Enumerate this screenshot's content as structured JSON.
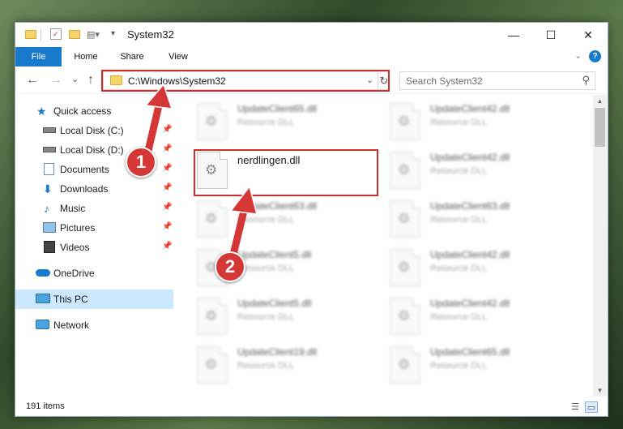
{
  "window": {
    "title": "System32",
    "controls": {
      "minimize": "—",
      "maximize": "☐",
      "close": "✕"
    }
  },
  "ribbon": {
    "tabs": [
      {
        "label": "File"
      },
      {
        "label": "Home"
      },
      {
        "label": "Share"
      },
      {
        "label": "View"
      }
    ],
    "help_label": "?"
  },
  "navigation": {
    "back": "←",
    "forward": "→",
    "recent": "⌄",
    "up": "↑",
    "address": "C:\\Windows\\System32",
    "refresh": "↻",
    "search_placeholder": "Search System32"
  },
  "sidebar": {
    "items": [
      {
        "label": "Quick access",
        "icon": "star-icon"
      },
      {
        "label": "Local Disk (C:)",
        "icon": "drive-icon",
        "pinned": true
      },
      {
        "label": "Local Disk (D:)",
        "icon": "drive-icon",
        "pinned": true
      },
      {
        "label": "Documents",
        "icon": "documents-icon",
        "pinned": true
      },
      {
        "label": "Downloads",
        "icon": "downloads-icon",
        "pinned": true
      },
      {
        "label": "Music",
        "icon": "music-icon",
        "pinned": true
      },
      {
        "label": "Pictures",
        "icon": "pictures-icon",
        "pinned": true
      },
      {
        "label": "Videos",
        "icon": "videos-icon",
        "pinned": true
      },
      {
        "label": "OneDrive",
        "icon": "onedrive-icon"
      },
      {
        "label": "This PC",
        "icon": "pc-icon",
        "selected": true
      },
      {
        "label": "Network",
        "icon": "network-icon"
      }
    ]
  },
  "files": {
    "left_column": [
      {
        "name": "UpdateClient65.dll",
        "type": "Resource DLL"
      },
      {
        "name": "nerdlingen.dll",
        "type": ""
      },
      {
        "name": "UpdateClient63.dll",
        "type": "Resource DLL"
      },
      {
        "name": "UpdateClient5.dll",
        "type": "Resource DLL"
      },
      {
        "name": "UpdateClient5.dll",
        "type": "Resource DLL"
      },
      {
        "name": "UpdateClient19.dll",
        "type": "Resource DLL"
      }
    ],
    "right_column": [
      {
        "name": "UpdateClient42.dll",
        "type": "Resource DLL"
      },
      {
        "name": "UpdateClient42.dll",
        "type": "Resource DLL"
      },
      {
        "name": "UpdateClient63.dll",
        "type": "Resource DLL"
      },
      {
        "name": "UpdateClient42.dll",
        "type": "Resource DLL"
      },
      {
        "name": "UpdateClient42.dll",
        "type": "Resource DLL"
      },
      {
        "name": "UpdateClient65.dll",
        "type": "Resource DLL"
      }
    ]
  },
  "status": {
    "item_count": "191 items"
  },
  "callouts": [
    {
      "label": "1"
    },
    {
      "label": "2"
    }
  ],
  "colors": {
    "accent": "#1979ca",
    "highlight": "#d12c2c",
    "callout": "#d53636",
    "selected": "#cce8ff"
  }
}
